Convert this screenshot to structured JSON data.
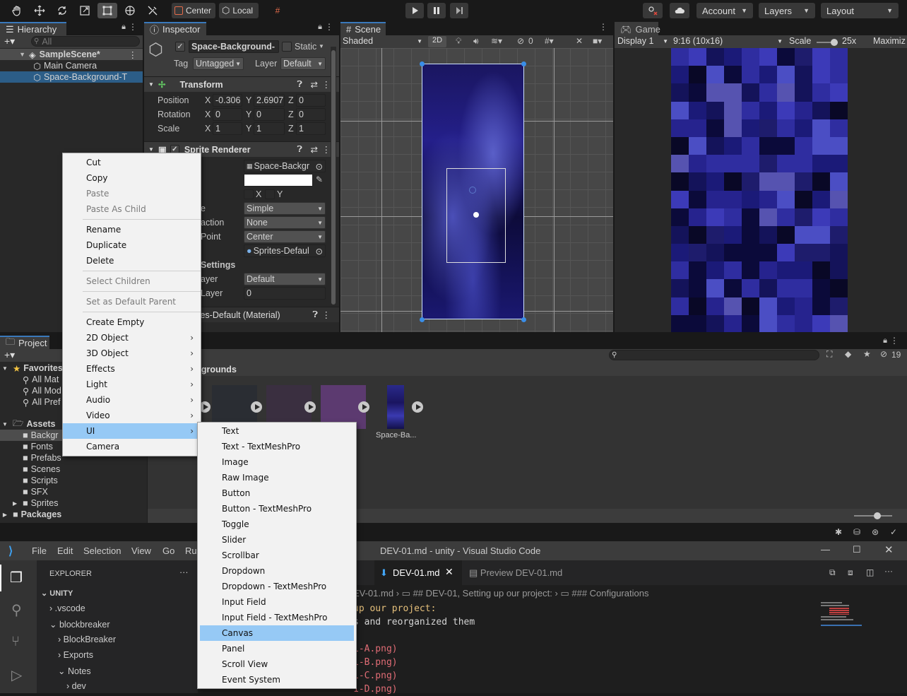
{
  "toolbar": {
    "pivot": "Center",
    "space": "Local",
    "account": "Account",
    "layers": "Layers",
    "layout": "Layout"
  },
  "hierarchy": {
    "tab": "Hierarchy",
    "search_placeholder": "All",
    "scene": "SampleScene*",
    "items": [
      "Main Camera",
      "Space-Background-T"
    ]
  },
  "inspector": {
    "tab": "Inspector",
    "object_name": "Space-Background-",
    "static_label": "Static",
    "tag_label": "Tag",
    "tag_value": "Untagged",
    "layer_label": "Layer",
    "layer_value": "Default",
    "transform": {
      "title": "Transform",
      "position_label": "Position",
      "rotation_label": "Rotation",
      "scale_label": "Scale",
      "position": [
        "-0.306",
        "2.6907",
        "0"
      ],
      "rotation": [
        "0",
        "0",
        "0"
      ],
      "scale": [
        "1",
        "1",
        "1"
      ],
      "axes": [
        "X",
        "Y",
        "Z"
      ]
    },
    "sprite_renderer": {
      "title": "Sprite Renderer",
      "sprite": "Space-Backgr",
      "flip_x": "X",
      "flip_y": "Y",
      "draw_mode_label": "e",
      "draw_mode": "Simple",
      "mask_label": "action",
      "mask": "None",
      "sort_point_label": "Point",
      "sort_point": "Center",
      "material": "Sprites-Defaul",
      "settings_label": "Settings",
      "sorting_layer_label": "ayer",
      "sorting_layer": "Default",
      "order_label": "Layer",
      "order": "0",
      "material_section": "tes-Default (Material)"
    }
  },
  "scene_view": {
    "tab": "Scene",
    "shading": "Shaded",
    "mode_2d": "2D",
    "gizmo_count": "0"
  },
  "game_view": {
    "tab": "Game",
    "display": "Display 1",
    "aspect": "9:16 (10x16)",
    "scale_label": "Scale",
    "scale_value": "25x",
    "maximize": "Maximiz"
  },
  "project": {
    "tab": "Project",
    "favorites_label": "Favorites",
    "favorites": [
      "All Mat",
      "All Mod",
      "All Pref"
    ],
    "assets_label": "Assets",
    "folders": [
      "Backgr",
      "Fonts",
      "Prefabs",
      "Scenes",
      "Scripts",
      "SFX",
      "Sprites"
    ],
    "packages_label": "Packages",
    "breadcrumb": "ckgrounds",
    "asset_name": "Space-Ba...",
    "hidden_count": "19"
  },
  "context_menu": {
    "items": [
      {
        "label": "Cut",
        "disabled": false
      },
      {
        "label": "Copy",
        "disabled": false
      },
      {
        "label": "Paste",
        "disabled": true
      },
      {
        "label": "Paste As Child",
        "disabled": true
      },
      {
        "sep": true
      },
      {
        "label": "Rename",
        "disabled": false
      },
      {
        "label": "Duplicate",
        "disabled": false
      },
      {
        "label": "Delete",
        "disabled": false
      },
      {
        "sep": true
      },
      {
        "label": "Select Children",
        "disabled": true
      },
      {
        "sep": true
      },
      {
        "label": "Set as Default Parent",
        "disabled": true
      },
      {
        "sep": true
      },
      {
        "label": "Create Empty",
        "disabled": false
      },
      {
        "label": "2D Object",
        "submenu": true
      },
      {
        "label": "3D Object",
        "submenu": true
      },
      {
        "label": "Effects",
        "submenu": true
      },
      {
        "label": "Light",
        "submenu": true
      },
      {
        "label": "Audio",
        "submenu": true
      },
      {
        "label": "Video",
        "submenu": true
      },
      {
        "label": "UI",
        "submenu": true,
        "highlight": true
      },
      {
        "label": "Camera",
        "disabled": false
      }
    ]
  },
  "ui_submenu": {
    "items": [
      "Text",
      "Text - TextMeshPro",
      "Image",
      "Raw Image",
      "Button",
      "Button - TextMeshPro",
      "Toggle",
      "Slider",
      "Scrollbar",
      "Dropdown",
      "Dropdown - TextMeshPro",
      "Input Field",
      "Input Field - TextMeshPro",
      "Canvas",
      "Panel",
      "Scroll View",
      "Event System"
    ],
    "highlighted": "Canvas"
  },
  "vscode": {
    "title": "DEV-01.md - unity - Visual Studio Code",
    "menu": [
      "File",
      "Edit",
      "Selection",
      "View",
      "Go",
      "Ru"
    ],
    "explorer_label": "EXPLORER",
    "root": "UNITY",
    "tree": [
      ".vscode",
      "blockbreaker",
      "BlockBreaker",
      "Exports",
      "Notes",
      "dev"
    ],
    "tab_active": "DEV-01.md",
    "tab_preview": "Preview DEV-01.md",
    "breadcrumb": [
      "EV-01.md",
      "## DEV-01, Setting up our project:",
      "### Configurations"
    ],
    "code_lines": [
      {
        "text": "up our project:",
        "color": "#e6c07b"
      },
      {
        "text": "s and reorganized them",
        "color": "#d4d4d4"
      },
      {
        "text": "",
        "color": "#d4d4d4"
      },
      {
        "text": "1-A.png)",
        "color": "#e06c75"
      },
      {
        "text": "1-B.png)",
        "color": "#e06c75"
      },
      {
        "text": "1-C.png)",
        "color": "#e06c75"
      },
      {
        "text": "1-D.png)",
        "color": "#e06c75"
      }
    ]
  }
}
